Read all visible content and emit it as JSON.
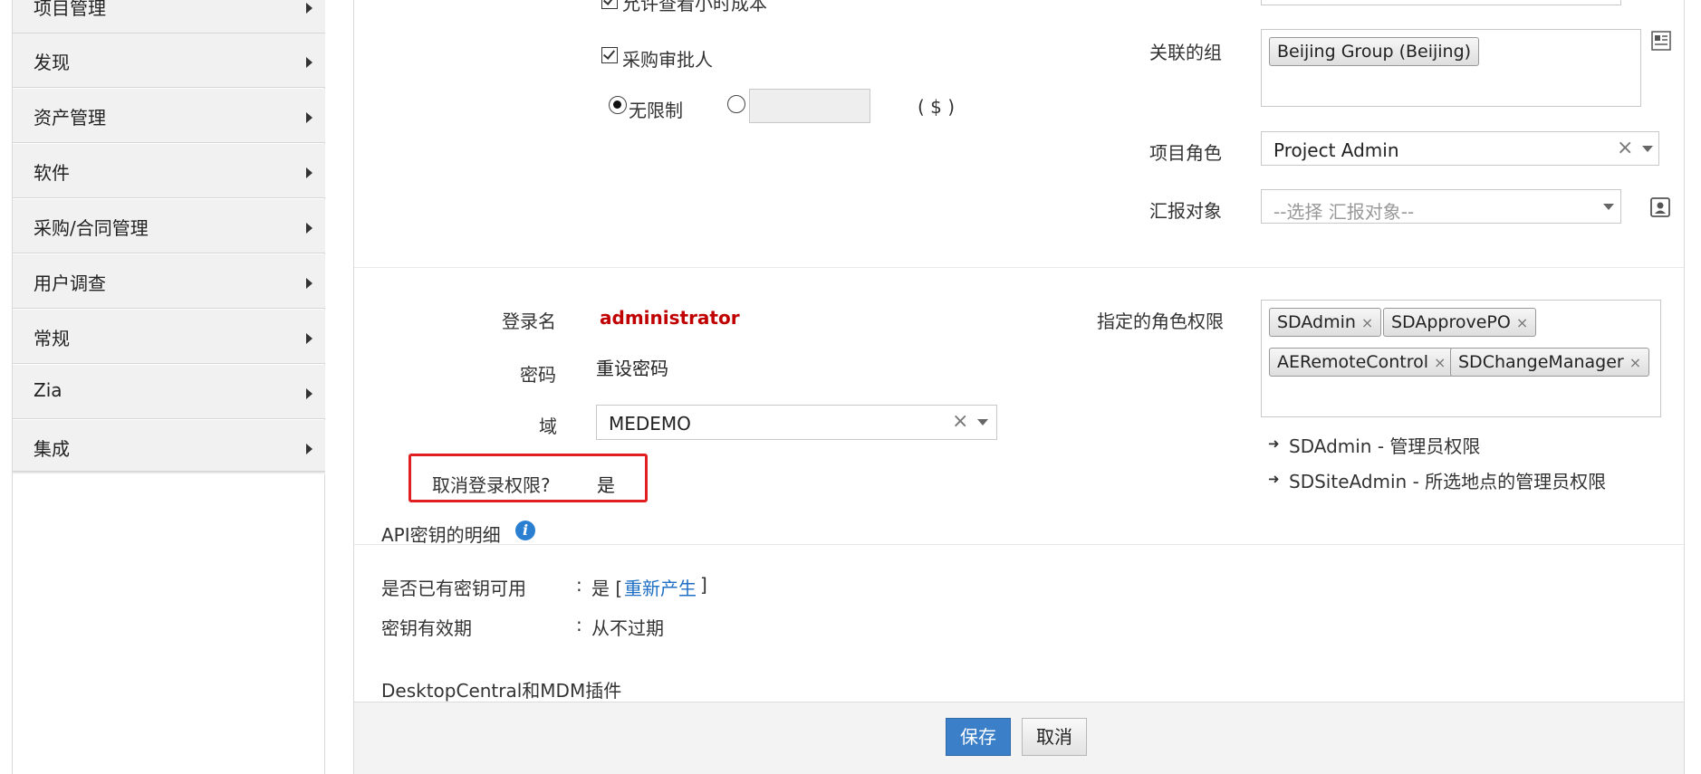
{
  "sidebar": {
    "items": [
      {
        "label": "项目管理"
      },
      {
        "label": "发现"
      },
      {
        "label": "资产管理"
      },
      {
        "label": "软件"
      },
      {
        "label": "采购/合同管理"
      },
      {
        "label": "用户调查"
      },
      {
        "label": "常规"
      },
      {
        "label": "Zia"
      },
      {
        "label": "集成"
      }
    ]
  },
  "form": {
    "view_time_cost_label": "允许查看小时成本",
    "purchase_approver_label": "采购审批人",
    "unlimited_label": "无限制",
    "currency_label": "( $ )",
    "associated_group_label": "关联的组",
    "associated_group_tag": "Beijing Group (Beijing)",
    "project_role_label": "项目角色",
    "project_role_value": "Project Admin",
    "reporting_to_label": "汇报对象",
    "reporting_to_placeholder": "--选择 汇报对象--",
    "login_name_label": "登录名",
    "login_name_value": "administrator",
    "password_label": "密码",
    "password_reset": "重设密码",
    "domain_label": "域",
    "domain_value": "MEDEMO",
    "revoke_login_label": "取消登录权限?",
    "revoke_login_value": "是",
    "assigned_roles_label": "指定的角色权限",
    "role_tags": [
      "SDAdmin",
      "SDApprovePO",
      "AERemoteControl",
      "SDChangeManager"
    ],
    "role_descriptions": [
      "SDAdmin - 管理员权限",
      "SDSiteAdmin - 所选地点的管理员权限"
    ],
    "remove_mark": "×"
  },
  "api": {
    "section_title": "API密钥的明细",
    "key_available_label": "是否已有密钥可用",
    "colon": ":",
    "key_available_value": "是 [",
    "regenerate_link": "重新产生",
    "bracket_close": "]",
    "key_expiry_label": "密钥有效期",
    "key_expiry_value": "从不过期",
    "plugin_section_title": "DesktopCentral和MDM插件"
  },
  "footer": {
    "save_label": "保存",
    "cancel_label": "取消"
  },
  "colors": {
    "accent": "#3a7fc8",
    "login_name": "#c00000",
    "highlight_box": "#e02020",
    "link": "#1f6fc4"
  }
}
